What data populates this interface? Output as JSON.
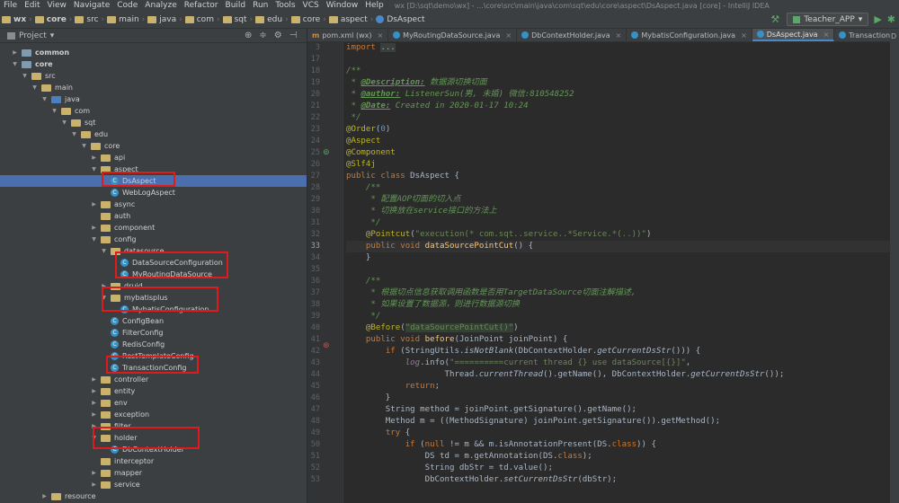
{
  "menubar": {
    "items": [
      "File",
      "Edit",
      "View",
      "Navigate",
      "Code",
      "Analyze",
      "Refactor",
      "Build",
      "Run",
      "Tools",
      "VCS",
      "Window",
      "Help"
    ],
    "window_title": "wx [D:\\sqt\\demo\\wx] - ...\\core\\src\\main\\java\\com\\sqt\\edu\\core\\aspect\\DsAspect.java [core] - IntelliJ IDEA"
  },
  "navbar": {
    "crumbs": [
      "wx",
      "core",
      "src",
      "main",
      "java",
      "com",
      "sqt",
      "edu",
      "core",
      "aspect",
      "DsAspect"
    ],
    "run_config": "Teacher_APP"
  },
  "project_panel": {
    "title": "Project",
    "tree": [
      {
        "label": "common",
        "depth": 1,
        "type": "module",
        "arrow": "▶",
        "bold": true
      },
      {
        "label": "core",
        "depth": 1,
        "type": "module",
        "arrow": "▼",
        "bold": true
      },
      {
        "label": "src",
        "depth": 2,
        "type": "folder",
        "arrow": "▼"
      },
      {
        "label": "main",
        "depth": 3,
        "type": "folder",
        "arrow": "▼"
      },
      {
        "label": "java",
        "depth": 4,
        "type": "src",
        "arrow": "▼"
      },
      {
        "label": "com",
        "depth": 5,
        "type": "folder",
        "arrow": "▼"
      },
      {
        "label": "sqt",
        "depth": 6,
        "type": "folder",
        "arrow": "▼"
      },
      {
        "label": "edu",
        "depth": 7,
        "type": "folder",
        "arrow": "▼"
      },
      {
        "label": "core",
        "depth": 8,
        "type": "folder",
        "arrow": "▼"
      },
      {
        "label": "api",
        "depth": 9,
        "type": "folder",
        "arrow": "▶"
      },
      {
        "label": "aspect",
        "depth": 9,
        "type": "folder",
        "arrow": "▼"
      },
      {
        "label": "DsAspect",
        "depth": 10,
        "type": "class",
        "arrow": "",
        "selected": true
      },
      {
        "label": "WebLogAspect",
        "depth": 10,
        "type": "class",
        "arrow": ""
      },
      {
        "label": "async",
        "depth": 9,
        "type": "folder",
        "arrow": "▶"
      },
      {
        "label": "auth",
        "depth": 9,
        "type": "folder",
        "arrow": ""
      },
      {
        "label": "component",
        "depth": 9,
        "type": "folder",
        "arrow": "▶"
      },
      {
        "label": "config",
        "depth": 9,
        "type": "folder",
        "arrow": "▼"
      },
      {
        "label": "datasource",
        "depth": 10,
        "type": "folder",
        "arrow": "▼"
      },
      {
        "label": "DataSourceConfiguration",
        "depth": 11,
        "type": "class",
        "arrow": ""
      },
      {
        "label": "MyRoutingDataSource",
        "depth": 11,
        "type": "class",
        "arrow": ""
      },
      {
        "label": "druid",
        "depth": 10,
        "type": "folder",
        "arrow": "▶"
      },
      {
        "label": "mybatisplus",
        "depth": 10,
        "type": "folder",
        "arrow": "▼"
      },
      {
        "label": "MybatisConfiguration",
        "depth": 11,
        "type": "class",
        "arrow": ""
      },
      {
        "label": "ConfigBean",
        "depth": 10,
        "type": "class",
        "arrow": ""
      },
      {
        "label": "FilterConfig",
        "depth": 10,
        "type": "class",
        "arrow": ""
      },
      {
        "label": "RedisConfig",
        "depth": 10,
        "type": "class",
        "arrow": ""
      },
      {
        "label": "RestTemplateConfig",
        "depth": 10,
        "type": "class",
        "arrow": ""
      },
      {
        "label": "TransactionConfig",
        "depth": 10,
        "type": "class",
        "arrow": ""
      },
      {
        "label": "controller",
        "depth": 9,
        "type": "folder",
        "arrow": "▶"
      },
      {
        "label": "entity",
        "depth": 9,
        "type": "folder",
        "arrow": "▶"
      },
      {
        "label": "env",
        "depth": 9,
        "type": "folder",
        "arrow": "▶"
      },
      {
        "label": "exception",
        "depth": 9,
        "type": "folder",
        "arrow": "▶"
      },
      {
        "label": "filter",
        "depth": 9,
        "type": "folder",
        "arrow": "▶"
      },
      {
        "label": "holder",
        "depth": 9,
        "type": "folder",
        "arrow": "▼"
      },
      {
        "label": "DbContextHolder",
        "depth": 10,
        "type": "class",
        "arrow": ""
      },
      {
        "label": "interceptor",
        "depth": 9,
        "type": "folder",
        "arrow": ""
      },
      {
        "label": "mapper",
        "depth": 9,
        "type": "folder",
        "arrow": "▶"
      },
      {
        "label": "service",
        "depth": 9,
        "type": "folder",
        "arrow": "▶"
      },
      {
        "label": "resource",
        "depth": 4,
        "type": "folder",
        "arrow": "▶"
      }
    ]
  },
  "editor": {
    "tabs": [
      {
        "label": "pom.xml (wx)",
        "icon": "m"
      },
      {
        "label": "MyRoutingDataSource.java",
        "icon": "c"
      },
      {
        "label": "DbContextHolder.java",
        "icon": "c"
      },
      {
        "label": "MybatisConfiguration.java",
        "icon": "c"
      },
      {
        "label": "DsAspect.java",
        "icon": "c",
        "active": true
      },
      {
        "label": "TransactionConfi",
        "icon": "c"
      }
    ],
    "line_numbers": [
      "3",
      "17",
      "18",
      "19",
      "20",
      "21",
      "22",
      "23",
      "24",
      "25",
      "26",
      "27",
      "28",
      "29",
      "30",
      "31",
      "32",
      "33",
      "34",
      "35",
      "36",
      "37",
      "38",
      "39",
      "40",
      "41",
      "42",
      "43",
      "44",
      "45",
      "46",
      "47",
      "48",
      "49",
      "50",
      "51",
      "52",
      "53"
    ],
    "current_line": "33"
  },
  "right_strip": {
    "label": "D"
  }
}
